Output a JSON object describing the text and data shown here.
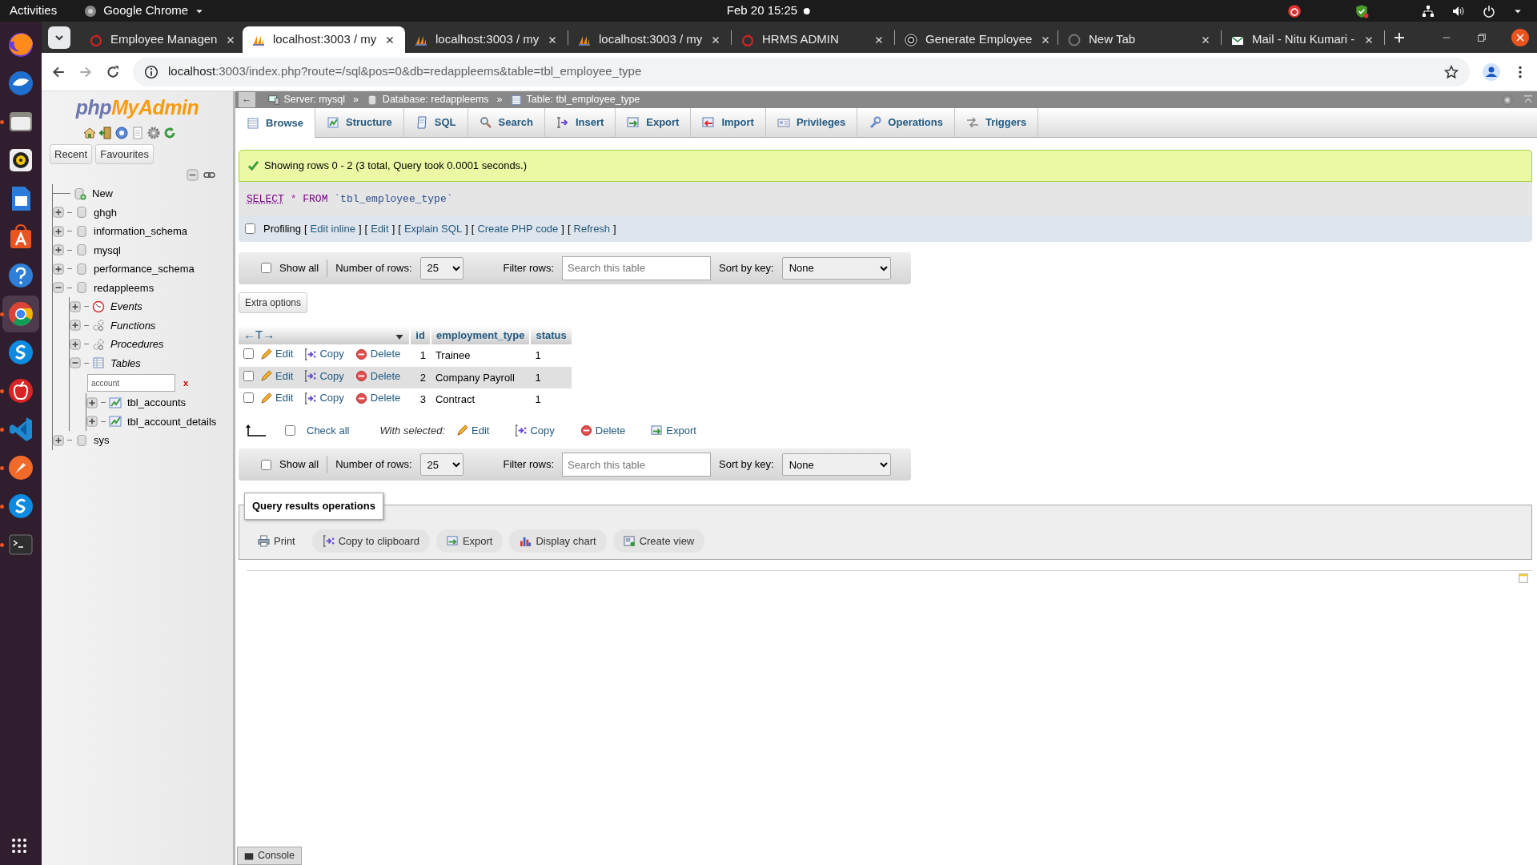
{
  "top_bar": {
    "activities": "Activities",
    "app_menu": "Google Chrome",
    "clock": "Feb 20  15:25"
  },
  "dock": [
    {
      "running": false,
      "selected": false
    },
    {
      "running": false,
      "selected": false
    },
    {
      "running": true,
      "selected": false
    },
    {
      "running": false,
      "selected": false
    },
    {
      "running": false,
      "selected": false
    },
    {
      "running": false,
      "selected": false
    },
    {
      "running": false,
      "selected": false
    },
    {
      "running": true,
      "selected": true
    },
    {
      "running": false,
      "selected": false
    },
    {
      "running": true,
      "selected": false
    },
    {
      "running": true,
      "selected": false
    },
    {
      "running": true,
      "selected": false
    },
    {
      "running": true,
      "selected": false
    },
    {
      "running": true,
      "selected": false
    }
  ],
  "browser": {
    "tabs": [
      {
        "title": "Employee Managen",
        "selected": false
      },
      {
        "title": "localhost:3003 / my",
        "selected": true
      },
      {
        "title": "localhost:3003 / my",
        "selected": false
      },
      {
        "title": "localhost:3003 / my",
        "selected": false
      },
      {
        "title": "HRMS ADMIN",
        "selected": false
      },
      {
        "title": "Generate Employee",
        "selected": false
      },
      {
        "title": "New Tab",
        "selected": false
      },
      {
        "title": "Mail - Nitu Kumari -",
        "selected": false
      }
    ],
    "address": {
      "host": "localhost",
      "rest": ":3003/index.php?route=/sql&pos=0&db=redappleems&table=tbl_employee_type"
    }
  },
  "sidebar": {
    "logo": [
      "php",
      "MyAdmin"
    ],
    "buttons": [
      "Recent",
      "Favourites"
    ],
    "tree": [
      {
        "label": "New",
        "kind": "new"
      },
      {
        "label": "ghgh",
        "kind": "database",
        "expanded": false
      },
      {
        "label": "information_schema",
        "kind": "database",
        "expanded": false
      },
      {
        "label": "mysql",
        "kind": "database",
        "expanded": false
      },
      {
        "label": "performance_schema",
        "kind": "database",
        "expanded": false
      },
      {
        "label": "redappleems",
        "kind": "database",
        "expanded": true,
        "children": [
          {
            "label": "Events",
            "kind": "events",
            "expanded": false
          },
          {
            "label": "Functions",
            "kind": "functions",
            "expanded": false
          },
          {
            "label": "Procedures",
            "kind": "procedures",
            "expanded": false
          },
          {
            "label": "Tables",
            "kind": "tables",
            "expanded": true,
            "filter": {
              "value": "account",
              "clear": "x"
            },
            "children": [
              {
                "label": "tbl_accounts",
                "kind": "table",
                "expanded": false
              },
              {
                "label": "tbl_account_details",
                "kind": "table",
                "expanded": false
              }
            ]
          }
        ]
      },
      {
        "label": "sys",
        "kind": "database",
        "expanded": false
      }
    ]
  },
  "breadcrumb": {
    "collapse": "←",
    "items": [
      {
        "label": "Server: mysql",
        "kind": "server",
        "separator": "»"
      },
      {
        "label": "Database: redappleems",
        "kind": "database",
        "separator": "»"
      },
      {
        "label": "Table: tbl_employee_type",
        "kind": "table"
      }
    ]
  },
  "tabs": [
    {
      "label": "Browse",
      "kind": "browse",
      "selected": true
    },
    {
      "label": "Structure",
      "kind": "structure",
      "selected": false
    },
    {
      "label": "SQL",
      "kind": "sql",
      "selected": false
    },
    {
      "label": "Search",
      "kind": "search",
      "selected": false
    },
    {
      "label": "Insert",
      "kind": "insert",
      "selected": false
    },
    {
      "label": "Export",
      "kind": "export",
      "selected": false
    },
    {
      "label": "Import",
      "kind": "import",
      "selected": false
    },
    {
      "label": "Privileges",
      "kind": "privileges",
      "selected": false
    },
    {
      "label": "Operations",
      "kind": "operations",
      "selected": false
    },
    {
      "label": "Triggers",
      "kind": "triggers",
      "selected": false
    }
  ],
  "message": "Showing rows 0 - 2 (3 total, Query took 0.0001 seconds.)",
  "sql": [
    {
      "text": "SELECT",
      "kind": "keyword"
    },
    {
      "text": "*",
      "kind": "operator"
    },
    {
      "text": "FROM",
      "kind": "keyword"
    },
    {
      "text": "`tbl_employee_type`",
      "kind": "identifier"
    }
  ],
  "profiling": {
    "label": "Profiling",
    "checked": false,
    "links": [
      {
        "before": "[",
        "label": "Edit inline",
        "after": "]"
      },
      {
        "before": "[",
        "label": "Edit",
        "after": "]"
      },
      {
        "before": "[",
        "label": "Explain SQL",
        "after": "]"
      },
      {
        "before": "[",
        "label": "Create PHP code",
        "after": "]"
      },
      {
        "before": "[",
        "label": "Refresh",
        "after": "]"
      }
    ]
  },
  "nav_top": {
    "show_all": "Show all",
    "show_all_checked": false,
    "rows_label": "Number of rows:",
    "rows_value": "25",
    "filter_label": "Filter rows:",
    "filter_placeholder": "Search this table",
    "sort_label": "Sort by key:",
    "sort_value": "None"
  },
  "extra_options": "Extra options",
  "table": {
    "resize": "←T→",
    "columns": [
      "id",
      "employment_type",
      "status"
    ],
    "rows": [
      {
        "checked": false,
        "hovered": false,
        "actions": [
          {
            "label": "Edit",
            "kind": "edit"
          },
          {
            "label": "Copy",
            "kind": "copy"
          },
          {
            "label": "Delete",
            "kind": "delete"
          }
        ],
        "cells": [
          "1",
          "Trainee",
          "1"
        ]
      },
      {
        "checked": false,
        "hovered": true,
        "actions": [
          {
            "label": "Edit",
            "kind": "edit"
          },
          {
            "label": "Copy",
            "kind": "copy"
          },
          {
            "label": "Delete",
            "kind": "delete"
          }
        ],
        "cells": [
          "2",
          "Company Payroll",
          "1"
        ]
      },
      {
        "checked": false,
        "hovered": false,
        "actions": [
          {
            "label": "Edit",
            "kind": "edit"
          },
          {
            "label": "Copy",
            "kind": "copy"
          },
          {
            "label": "Delete",
            "kind": "delete"
          }
        ],
        "cells": [
          "3",
          "Contract",
          "1"
        ]
      }
    ]
  },
  "bulk": {
    "check_all": "Check all",
    "checked": false,
    "with_selected": "With selected:",
    "actions": [
      {
        "label": "Edit",
        "kind": "edit"
      },
      {
        "label": "Copy",
        "kind": "copy"
      },
      {
        "label": "Delete",
        "kind": "delete"
      },
      {
        "label": "Export",
        "kind": "export"
      }
    ]
  },
  "nav_bottom": {
    "show_all": "Show all",
    "show_all_checked": false,
    "rows_label": "Number of rows:",
    "rows_value": "25",
    "filter_label": "Filter rows:",
    "filter_placeholder": "Search this table",
    "sort_label": "Sort by key:",
    "sort_value": "None"
  },
  "query_ops": {
    "legend": "Query results operations",
    "buttons": [
      {
        "label": "Print",
        "kind": "print"
      },
      {
        "label": "Copy to clipboard",
        "kind": "copy"
      },
      {
        "label": "Export",
        "kind": "export"
      },
      {
        "label": "Display chart",
        "kind": "chart"
      },
      {
        "label": "Create view",
        "kind": "view"
      }
    ]
  },
  "console": "Console"
}
